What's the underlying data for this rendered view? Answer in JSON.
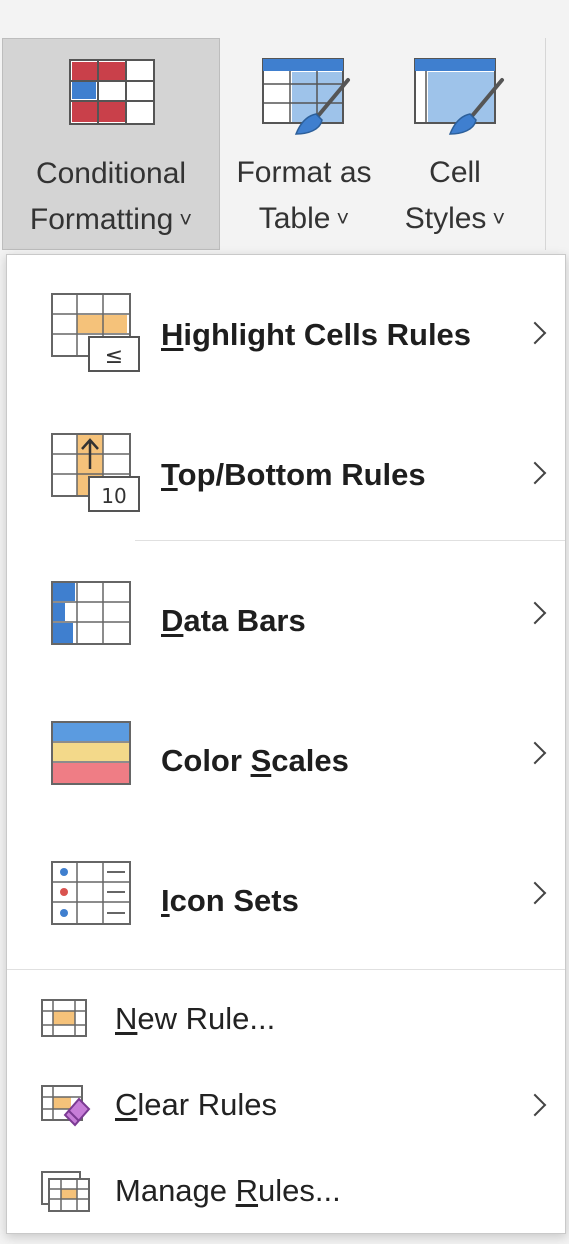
{
  "ribbon": {
    "conditional_formatting": {
      "line1": "Conditional",
      "line2": "Formatting",
      "chevron": "˅"
    },
    "format_as_table": {
      "line1": "Format as",
      "line2": "Table",
      "chevron": "˅"
    },
    "cell_styles": {
      "line1": "Cell",
      "line2": "Styles",
      "chevron": "˅"
    }
  },
  "menu": {
    "highlight": {
      "key": "H",
      "rest": "ighlight Cells Rules",
      "icon": "highlight-cells-icon",
      "badge": "≤"
    },
    "topbottom": {
      "key": "T",
      "rest": "op/Bottom Rules",
      "icon": "top-bottom-icon",
      "badge": "10"
    },
    "databars": {
      "key": "D",
      "rest": "ata Bars",
      "icon": "data-bars-icon"
    },
    "colorscales": {
      "pre": "Color ",
      "key": "S",
      "rest": "cales",
      "icon": "color-scales-icon"
    },
    "iconsets": {
      "key": "I",
      "rest": "con Sets",
      "icon": "icon-sets-icon"
    },
    "newrule": {
      "key": "N",
      "rest": "ew Rule...",
      "icon": "new-rule-icon"
    },
    "clearrules": {
      "key": "C",
      "rest": "lear Rules",
      "icon": "clear-rules-icon"
    },
    "managerules": {
      "pre": "Manage ",
      "key": "R",
      "rest": "ules...",
      "icon": "manage-rules-icon"
    }
  },
  "colors": {
    "accent_blue": "#4a90d9",
    "accent_red": "#d9534f",
    "accent_orange": "#f5c27a",
    "accent_purple": "#9b59b6"
  }
}
